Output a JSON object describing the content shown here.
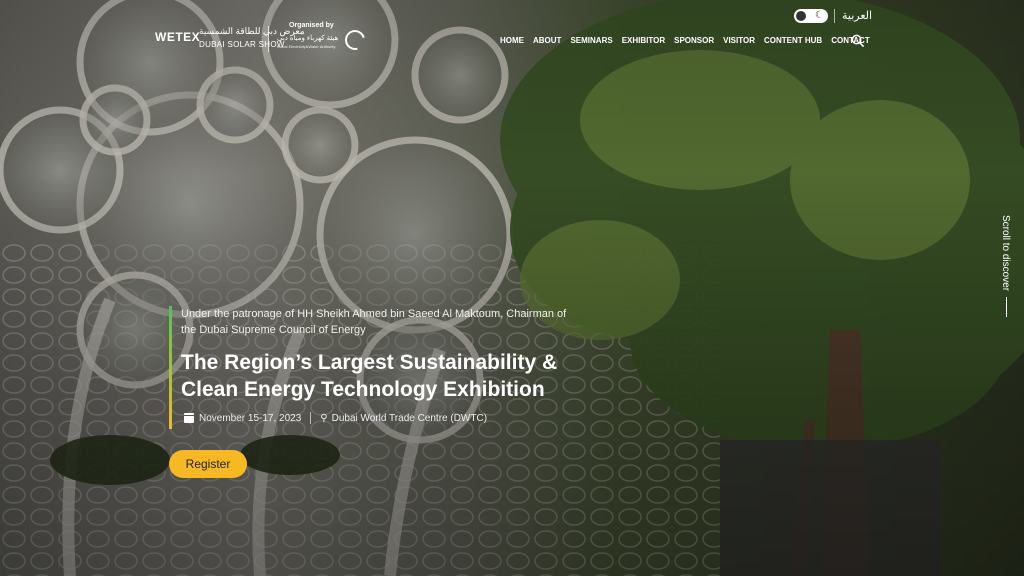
{
  "header": {
    "logo": {
      "wetex": "WETEX",
      "arabic_name": "معرض دبي للطاقة الشمسية",
      "dubai_solar_show": "DUBAI SOLAR SHOW",
      "organised_by": "Organised by",
      "organiser_arabic": "هيئة كهرباء ومياه دبي",
      "organiser_english": "Dubai Electricity&Water Authority"
    },
    "language_link": "العربية",
    "nav": [
      "HOME",
      "ABOUT",
      "SEMINARS",
      "EXHIBITOR",
      "SPONSOR",
      "VISITOR",
      "CONTENT HUB",
      "CONTACT"
    ]
  },
  "hero": {
    "patronage": "Under the patronage of HH Sheikh Ahmed bin Saeed Al Maktoum, Chairman of the Dubai Supreme Council of Energy",
    "headline": "The Region’s Largest Sustainability & Clean Energy Technology Exhibition",
    "date": "November 15-17, 2023",
    "venue": "Dubai World Trade Centre (DWTC)",
    "register_label": "Register",
    "scroll_hint": "Scroll to discover"
  },
  "colors": {
    "accent": "#f6b924",
    "bar_top": "#56c15a",
    "bar_bottom": "#f5b92a"
  },
  "icons": [
    "theme-toggle-icon",
    "search-icon",
    "calendar-icon",
    "location-pin-icon"
  ]
}
